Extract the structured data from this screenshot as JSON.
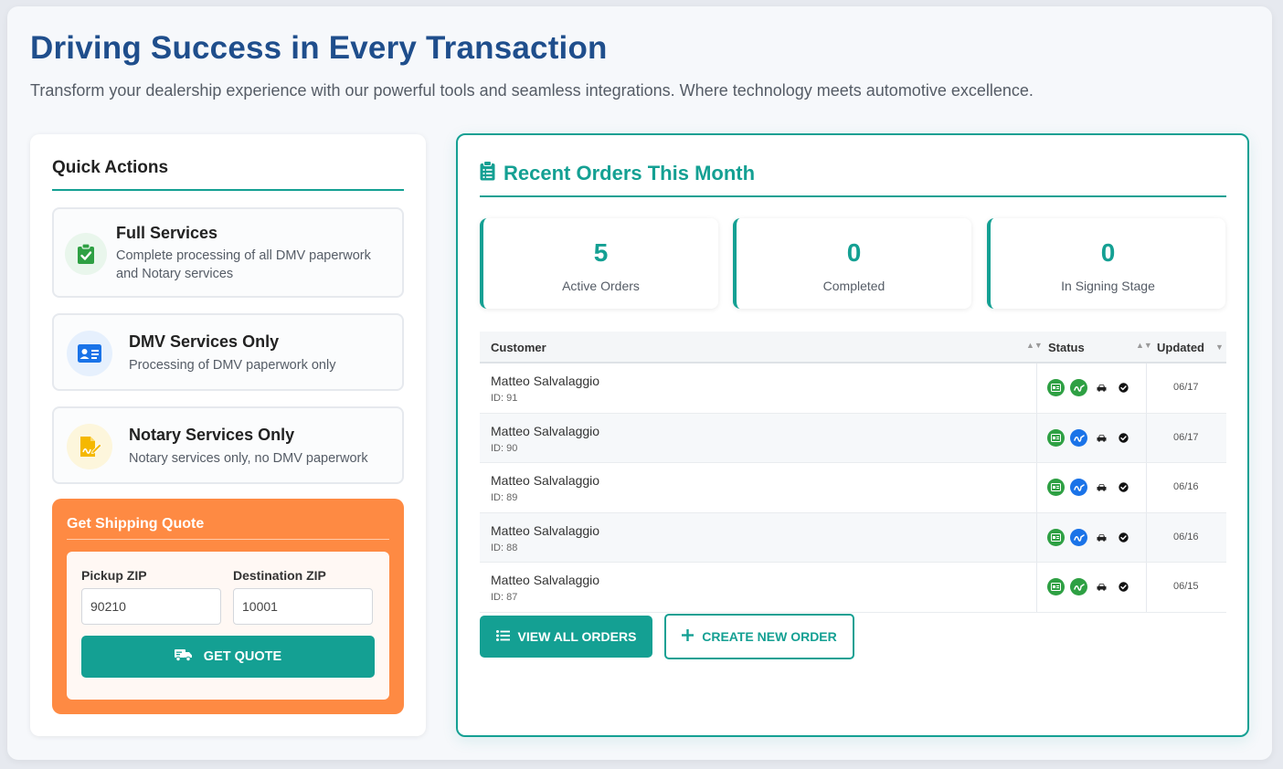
{
  "hero": {
    "title": "Driving Success in Every Transaction",
    "subtitle": "Transform your dealership experience with our powerful tools and seamless integrations. Where technology meets automotive excellence."
  },
  "quick_actions": {
    "title": "Quick Actions",
    "items": [
      {
        "title": "Full Services",
        "desc_line1": "Complete processing of all DMV paperwork",
        "desc_line2": "and Notary services",
        "icon": "clipboard-check-icon",
        "color": "#2ea043"
      },
      {
        "title": "DMV Services Only",
        "desc_line1": "Processing of DMV paperwork only",
        "icon": "id-card-icon",
        "color": "#1a73e8"
      },
      {
        "title": "Notary Services Only",
        "desc_line1": "Notary services only, no DMV paperwork",
        "icon": "signature-icon",
        "color": "#f5b800"
      }
    ]
  },
  "shipping": {
    "title": "Get Shipping Quote",
    "pickup_label": "Pickup ZIP",
    "pickup_value": "90210",
    "destination_label": "Destination ZIP",
    "destination_value": "10001",
    "button_label": "GET QUOTE"
  },
  "orders": {
    "title": "Recent Orders This Month",
    "stats": [
      {
        "value": "5",
        "label": "Active Orders"
      },
      {
        "value": "0",
        "label": "Completed"
      },
      {
        "value": "0",
        "label": "In Signing Stage"
      }
    ],
    "columns": {
      "customer": "Customer",
      "status": "Status",
      "updated": "Updated"
    },
    "rows": [
      {
        "name": "Matteo Salvalaggio",
        "id": "ID: 91",
        "updated": "06/17",
        "sign_color": "#2ea043"
      },
      {
        "name": "Matteo Salvalaggio",
        "id": "ID: 90",
        "updated": "06/17",
        "sign_color": "#1a73e8"
      },
      {
        "name": "Matteo Salvalaggio",
        "id": "ID: 89",
        "updated": "06/16",
        "sign_color": "#1a73e8"
      },
      {
        "name": "Matteo Salvalaggio",
        "id": "ID: 88",
        "updated": "06/16",
        "sign_color": "#1a73e8"
      },
      {
        "name": "Matteo Salvalaggio",
        "id": "ID: 87",
        "updated": "06/15",
        "sign_color": "#2ea043"
      }
    ],
    "view_all_label": "VIEW ALL ORDERS",
    "create_label": "CREATE NEW ORDER"
  },
  "colors": {
    "accent": "#14a093",
    "brand_blue": "#1f4e8c",
    "shipping": "#fe8a43"
  }
}
